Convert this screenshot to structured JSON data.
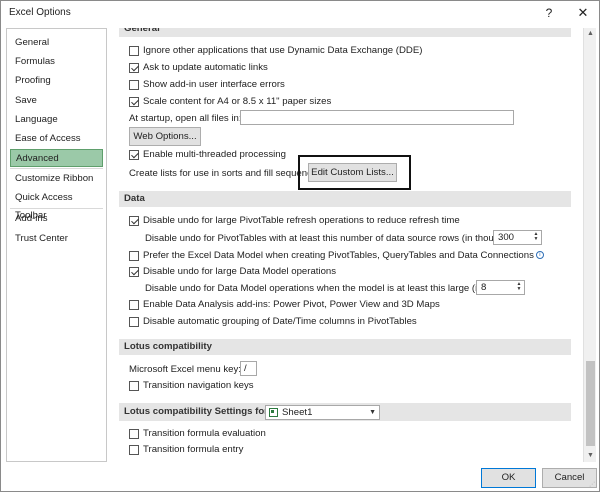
{
  "window": {
    "title": "Excel Options",
    "help": "?",
    "close": "✕"
  },
  "sidebar": {
    "items": [
      {
        "label": "General"
      },
      {
        "label": "Formulas"
      },
      {
        "label": "Proofing"
      },
      {
        "label": "Save"
      },
      {
        "label": "Language"
      },
      {
        "label": "Ease of Access"
      },
      {
        "label": "Advanced",
        "selected": true
      },
      {
        "label": "Customize Ribbon"
      },
      {
        "label": "Quick Access Toolbar"
      },
      {
        "label": "Add-ins"
      },
      {
        "label": "Trust Center"
      }
    ]
  },
  "general": {
    "header": "General",
    "ignore_dde": {
      "label": "Ignore other applications that use Dynamic Data Exchange (DDE)",
      "checked": false
    },
    "ask_update_links": {
      "label": "Ask to update automatic links",
      "checked": true
    },
    "show_addin_errors": {
      "label": "Show add-in user interface errors",
      "checked": false
    },
    "scale_content": {
      "label": "Scale content for A4 or 8.5 x 11\" paper sizes",
      "checked": true
    },
    "startup_label": "At startup, open all files in:",
    "startup_value": "",
    "web_options_button": "Web Options...",
    "multithreaded": {
      "label": "Enable multi-threaded processing",
      "checked": true
    },
    "custom_lists_label": "Create lists for use in sorts and fill sequences:",
    "edit_custom_lists_button": "Edit Custom Lists..."
  },
  "data": {
    "header": "Data",
    "disable_undo_pivot": {
      "label": "Disable undo for large PivotTable refresh operations to reduce refresh time",
      "checked": true
    },
    "pivot_rows_label": "Disable undo for PivotTables with at least this number of data source rows (in thousands):",
    "pivot_rows_value": "300",
    "prefer_data_model": {
      "label": "Prefer the Excel Data Model when creating PivotTables, QueryTables and Data Connections",
      "checked": false
    },
    "info_icon": "i",
    "disable_undo_model": {
      "label": "Disable undo for large Data Model operations",
      "checked": true
    },
    "model_size_label": "Disable undo for Data Model operations when the model is at least this large (in MB):",
    "model_size_value": "8",
    "enable_addins": {
      "label": "Enable Data Analysis add-ins: Power Pivot, Power View and 3D Maps",
      "checked": false
    },
    "disable_grouping": {
      "label": "Disable automatic grouping of Date/Time columns in PivotTables",
      "checked": false
    }
  },
  "lotus": {
    "header": "Lotus compatibility",
    "menu_key_label": "Microsoft Excel menu key:",
    "menu_key_value": "/",
    "transition_nav": {
      "label": "Transition navigation keys",
      "checked": false
    }
  },
  "lotus_settings": {
    "header": "Lotus compatibility Settings for:",
    "sheet_value": "Sheet1",
    "transition_formula_eval": {
      "label": "Transition formula evaluation",
      "checked": false
    },
    "transition_formula_entry": {
      "label": "Transition formula entry",
      "checked": false
    }
  },
  "footer": {
    "ok": "OK",
    "cancel": "Cancel"
  },
  "colors": {
    "selected_nav": "#9bc9a8",
    "section_header": "#e5e5e5",
    "accent": "#0078d7"
  }
}
